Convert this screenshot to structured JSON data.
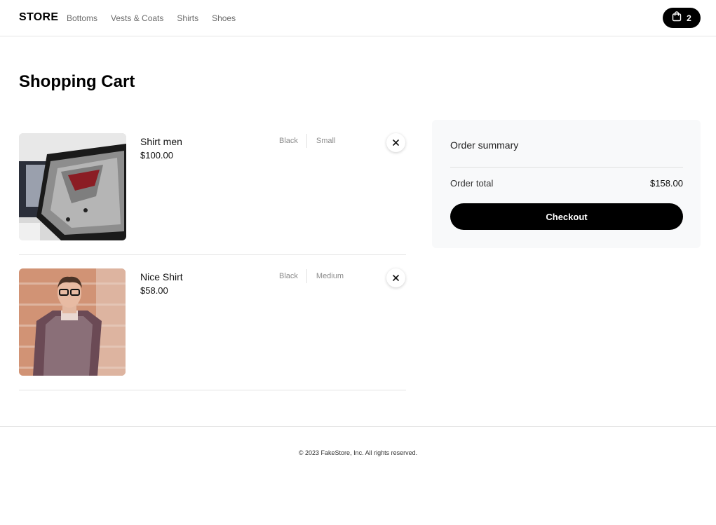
{
  "header": {
    "logo": "STORE",
    "nav": [
      "Bottoms",
      "Vests & Coats",
      "Shirts",
      "Shoes"
    ],
    "cart_count": "2"
  },
  "page_title": "Shopping Cart",
  "cart": {
    "items": [
      {
        "name": "Shirt men",
        "price": "$100.00",
        "color": "Black",
        "size": "Small",
        "image": "shirt-on-display-photo"
      },
      {
        "name": "Nice Shirt",
        "price": "$58.00",
        "color": "Black",
        "size": "Medium",
        "image": "man-in-plaid-shirt-photo"
      }
    ]
  },
  "summary": {
    "title": "Order summary",
    "total_label": "Order total",
    "total_value": "$158.00",
    "checkout_label": "Checkout"
  },
  "footer": {
    "copyright": "© 2023 FakeStore, Inc. All rights reserved."
  },
  "colors": {
    "accent": "#000000",
    "summary_bg": "#f8f9fa"
  }
}
